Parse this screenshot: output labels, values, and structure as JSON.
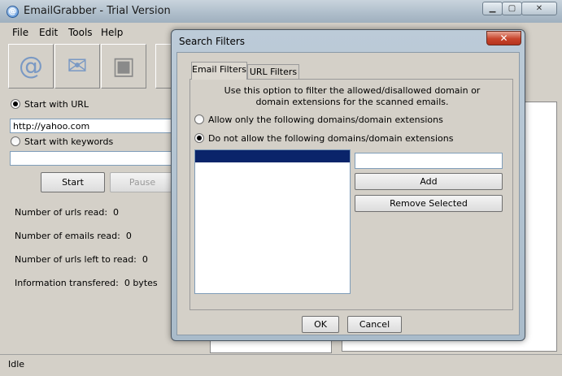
{
  "main": {
    "title": "EmailGrabber - Trial Version",
    "app_icon": "at-sign-icon",
    "menu": [
      "File",
      "Edit",
      "Tools",
      "Help"
    ],
    "toolbar_icons": [
      "email-at-icon",
      "open-envelope-icon",
      "save-disk-icon"
    ],
    "start_with_url_label": "Start with URL",
    "url_value": "http://yahoo.com",
    "start_with_keywords_label": "Start with keywords",
    "keywords_value": "",
    "start_label": "Start",
    "pause_label": "Pause",
    "stats": [
      {
        "label": "Number of urls read:",
        "value": "0"
      },
      {
        "label": "Number of emails read:",
        "value": "0"
      },
      {
        "label": "Number of urls left to read:",
        "value": "0"
      },
      {
        "label": "Information transfered:",
        "value": "0 bytes"
      }
    ],
    "status": "Idle"
  },
  "dialog": {
    "title": "Search Filters",
    "close_glyph": "✕",
    "tabs": [
      "Email Filters",
      "URL Filters"
    ],
    "description_line1": "Use this option to filter the allowed/disallowed domain or",
    "description_line2": "domain extensions for the scanned emails.",
    "allow_only_label": "Allow only the following domains/domain extensions",
    "do_not_allow_label": "Do not allow the following domains/domain extensions",
    "domain_input_value": "",
    "add_label": "Add",
    "remove_selected_label": "Remove Selected",
    "ok_label": "OK",
    "cancel_label": "Cancel"
  },
  "colors": {
    "selection": "#0a246a",
    "window_bg": "#d4d0c8",
    "titlebar": "#aebdca"
  }
}
